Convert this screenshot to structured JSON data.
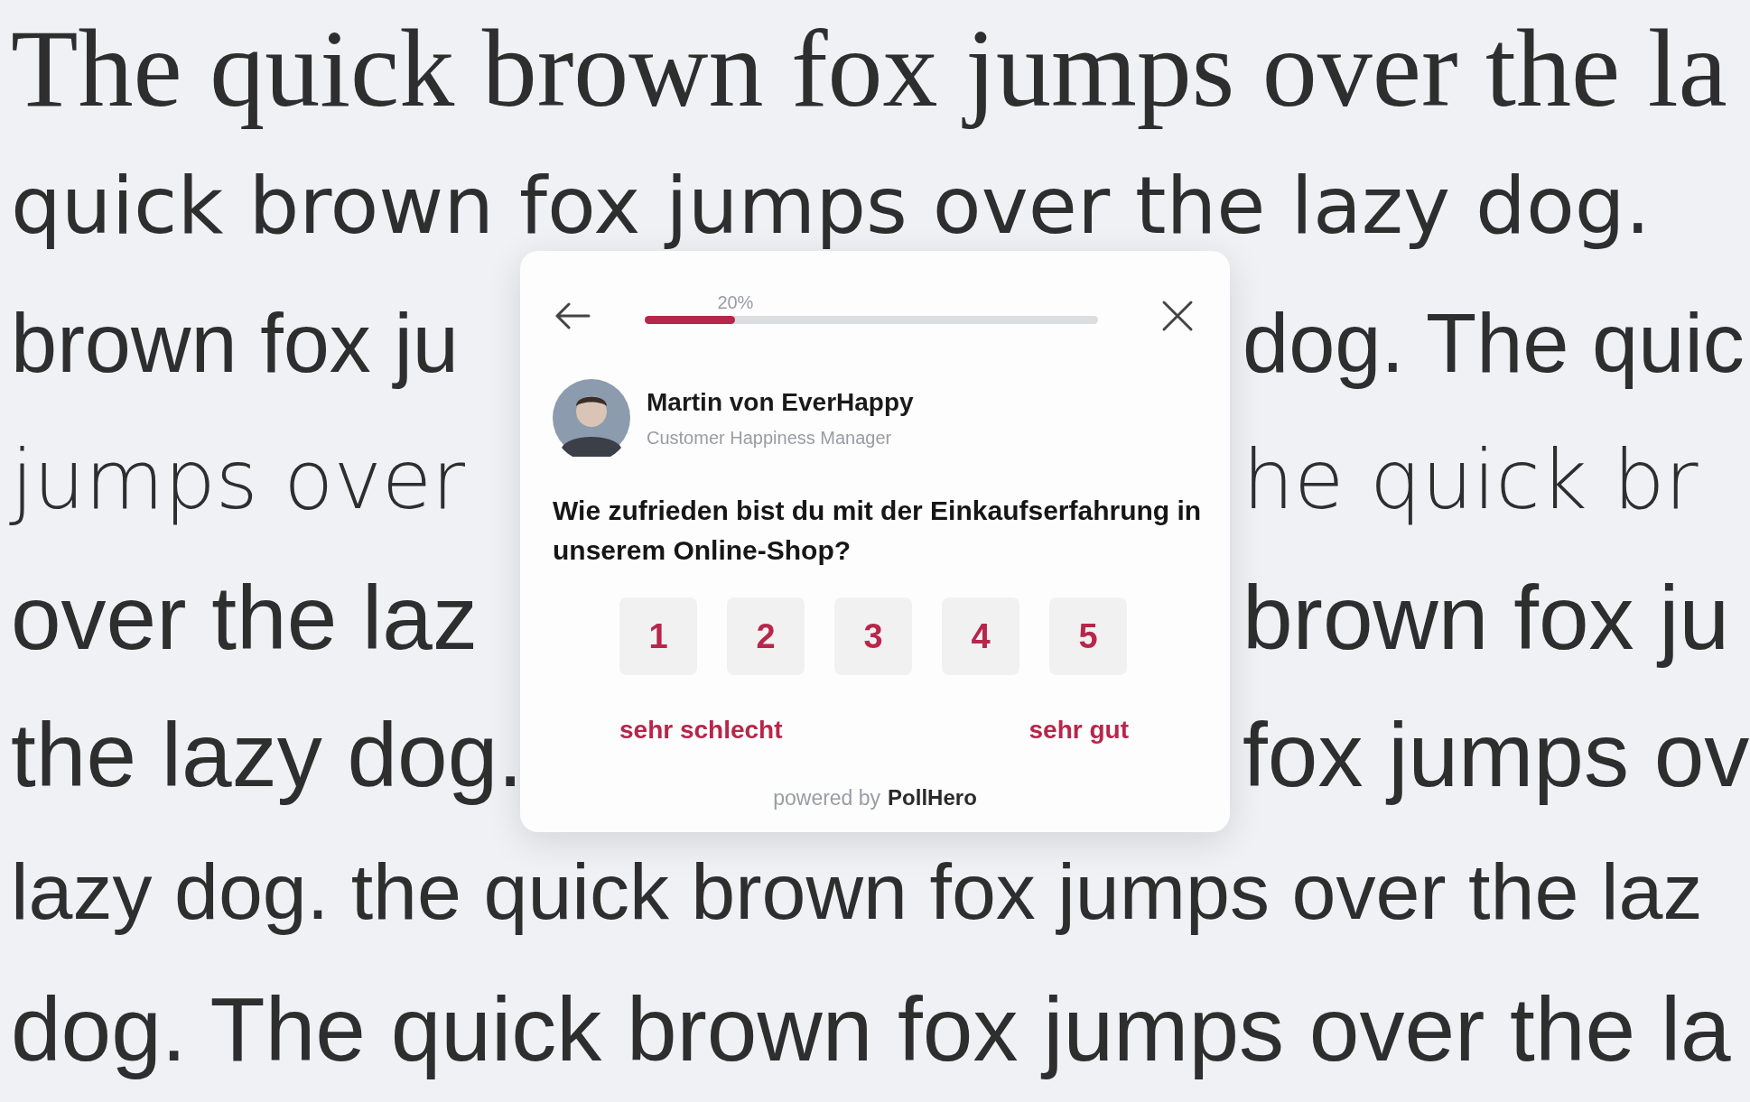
{
  "background_lines": [
    {
      "segments": [
        "The quick brown fox jumps over the la"
      ]
    },
    {
      "segments": [
        "quick brown fox jumps over the lazy dog."
      ]
    },
    {
      "segments": [
        "brown fox ju",
        "dog. The quic"
      ]
    },
    {
      "segments": [
        "jumps over",
        "he quick br"
      ]
    },
    {
      "segments": [
        "over the laz",
        "brown fox ju"
      ]
    },
    {
      "segments": [
        "the lazy dog.",
        "fox jumps ov"
      ]
    },
    {
      "segments": [
        "lazy dog. the quick brown fox jumps over the laz"
      ]
    },
    {
      "segments": [
        "dog. The quick brown fox jumps over the la"
      ]
    }
  ],
  "survey": {
    "progress": {
      "label": "20%",
      "level": 0.2
    },
    "sender": {
      "name": "Martin von EverHappy",
      "role": "Customer Happiness Manager"
    },
    "question": "Wie zufrieden bist du mit der Einkaufserfahrung in unserem Online-Shop?",
    "options": [
      {
        "label": "1",
        "selected": false
      },
      {
        "label": "2",
        "selected": false
      },
      {
        "label": "3",
        "selected": false
      },
      {
        "label": "4",
        "selected": false
      },
      {
        "label": "5",
        "selected": false
      }
    ],
    "scale_labels": {
      "low": "sehr schlecht",
      "high": "sehr gut"
    },
    "footer": {
      "prefix": "powered by",
      "brand": "PollHero"
    }
  }
}
